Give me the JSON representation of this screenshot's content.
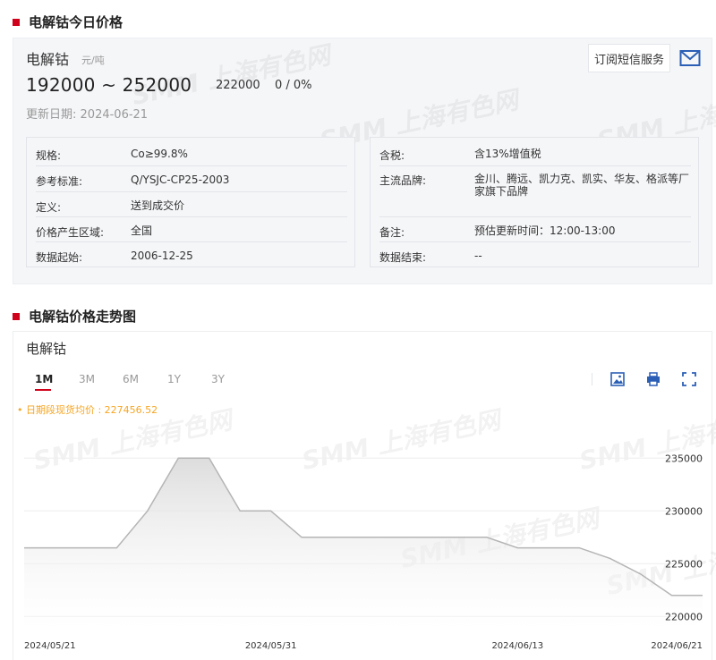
{
  "price_section": {
    "title": "电解钴今日价格",
    "product_name": "电解钴",
    "unit": "元/吨",
    "price_low": "192000",
    "price_sep": "~",
    "price_high": "252000",
    "average": "222000",
    "change": "0 / 0%",
    "update_label": "更新日期:",
    "update_date": "2024-06-21",
    "subscribe_label": "订阅短信服务",
    "left_info": [
      {
        "key": "规格:",
        "value": "Co≥99.8%"
      },
      {
        "key": "参考标准:",
        "value": "Q/YSJC-CP25-2003"
      },
      {
        "key": "定义:",
        "value": "送到成交价"
      },
      {
        "key": "价格产生区域:",
        "value": "全国"
      },
      {
        "key": "数据起始:",
        "value": "2006-12-25"
      }
    ],
    "right_info": [
      {
        "key": "含税:",
        "value": "含13%增值税"
      },
      {
        "key": "主流品牌:",
        "value": "金川、腾远、凯力克、凯实、华友、格派等厂家旗下品牌"
      },
      {
        "key": "备注:",
        "value": "预估更新时间：12:00-13:00"
      },
      {
        "key": "数据结束:",
        "value": "--"
      }
    ]
  },
  "trend_section": {
    "title": "电解钴价格走势图",
    "chart_name": "电解钴",
    "tabs": [
      "1M",
      "3M",
      "6M",
      "1Y",
      "3Y"
    ],
    "active_tab": "1M",
    "avg_note": "• 日期段现货均价 : 227456.52"
  },
  "watermark": "SMM 上海有色网",
  "icons": [
    "mail-icon",
    "save-image-icon",
    "print-icon",
    "fullscreen-icon"
  ],
  "colors": {
    "accent": "#d0021b",
    "note": "#f5a623",
    "line": "#b5b5b5",
    "mail": "#2b5fb5"
  },
  "chart_data": {
    "type": "area",
    "x": [
      "2024/05/21",
      "2024/05/22",
      "2024/05/23",
      "2024/05/24",
      "2024/05/27",
      "2024/05/28",
      "2024/05/29",
      "2024/05/30",
      "2024/05/31",
      "2024/06/03",
      "2024/06/04",
      "2024/06/05",
      "2024/06/06",
      "2024/06/07",
      "2024/06/11",
      "2024/06/12",
      "2024/06/13",
      "2024/06/14",
      "2024/06/17",
      "2024/06/18",
      "2024/06/19",
      "2024/06/20",
      "2024/06/21"
    ],
    "series": [
      {
        "values": [
          226500,
          226500,
          226500,
          226500,
          230000,
          235000,
          235000,
          230000,
          230000,
          227500,
          227500,
          227500,
          227500,
          227500,
          227500,
          227500,
          226500,
          226500,
          226500,
          225500,
          224000,
          222000,
          222000
        ]
      }
    ],
    "xlabel": "",
    "ylabel": "",
    "ylim": [
      218500,
      238500
    ],
    "yticks": [
      235000,
      230000,
      225000,
      220000
    ],
    "xtick_labels": [
      "2024/05/21",
      "2024/05/31",
      "2024/06/13",
      "2024/06/21"
    ],
    "grid": true,
    "y_axis_position": "right"
  }
}
